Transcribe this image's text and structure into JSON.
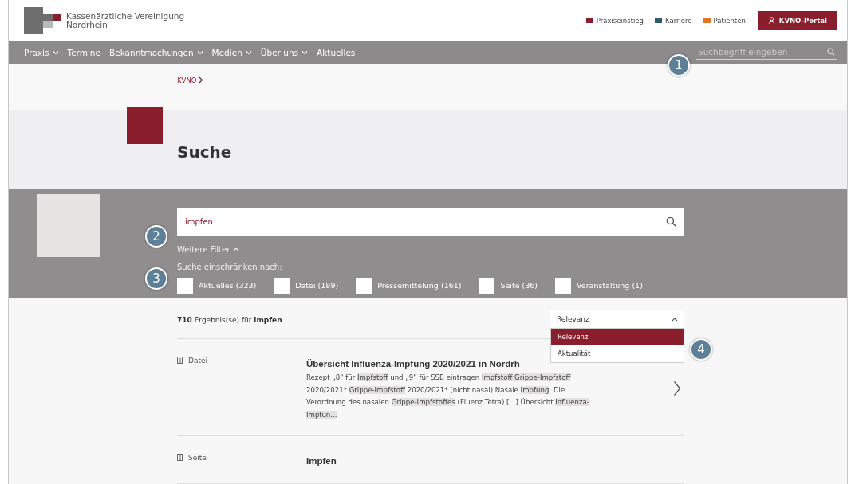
{
  "header": {
    "logo_lines": [
      "Kassenärztliche Vereinigung",
      "Nordrhein"
    ],
    "links": [
      {
        "label": "Praxiseinstieg",
        "color": "#8b1e2d"
      },
      {
        "label": "Karriere",
        "color": "#2e5a6b"
      },
      {
        "label": "Patienten",
        "color": "#e0782a"
      }
    ],
    "portal_button": "KVNO-Portal"
  },
  "nav": {
    "items": [
      {
        "label": "Praxis",
        "has_menu": true
      },
      {
        "label": "Termine",
        "has_menu": false
      },
      {
        "label": "Bekanntmachungen",
        "has_menu": true
      },
      {
        "label": "Medien",
        "has_menu": true
      },
      {
        "label": "Über uns",
        "has_menu": true
      },
      {
        "label": "Aktuelles",
        "has_menu": false
      }
    ],
    "search": {
      "placeholder": "Suchbegriff eingeben"
    }
  },
  "breadcrumb": [
    "KVNO"
  ],
  "title": "Suche",
  "filter": {
    "query": "impfen",
    "more_filters": "Weitere Filter",
    "expanded": true,
    "restrict_label": "Suche einschränken nach:",
    "options": [
      {
        "label": "Aktuelles (323)",
        "checked": false
      },
      {
        "label": "Datei (189)",
        "checked": false
      },
      {
        "label": "Pressemittelung (161)",
        "checked": false
      },
      {
        "label": "Seite (36)",
        "checked": false
      },
      {
        "label": "Veranstaltung (1)",
        "checked": false
      }
    ]
  },
  "results": {
    "summary": "**710** Ergebnis(se) für **impfen**",
    "sort": {
      "value": "Relevanz",
      "expanded": true,
      "options": [
        {
          "label": "Relevanz",
          "selected": true
        },
        {
          "label": "Aktualität",
          "selected": false
        }
      ]
    },
    "items": [
      {
        "type": "Datei",
        "title": "Übersicht Influenza-Impfung 2020/2021 in Nordrh",
        "excerpt": [
          {
            "text": "Rezept „8“ für ",
            "highlighted": false
          },
          {
            "text": "Impfstoff",
            "highlighted": true
          },
          {
            "text": " und „9“ für SSB eintragen ",
            "highlighted": false
          },
          {
            "text": "Impfstoff Grippe-Impfstoff",
            "highlighted": true
          },
          {
            "text": " 2020/2021* ",
            "highlighted": false
          },
          {
            "text": "Grippe-Impfstoff",
            "highlighted": true
          },
          {
            "text": " 2020/2021* (nicht nasal) Nasale ",
            "highlighted": false
          },
          {
            "text": "Impfung",
            "highlighted": true
          },
          {
            "text": ": Die Verordnung des nasalen ",
            "highlighted": false
          },
          {
            "text": "Grippe-Impfstoffes",
            "highlighted": true
          },
          {
            "text": " (Fluenz Tetra) [...] Übersicht ",
            "highlighted": false
          },
          {
            "text": "Influenza-Impfun...",
            "highlighted": true
          }
        ]
      },
      {
        "type": "Seite",
        "title": "Impfen"
      }
    ]
  },
  "annotations": [
    "1",
    "2",
    "3",
    "4"
  ]
}
